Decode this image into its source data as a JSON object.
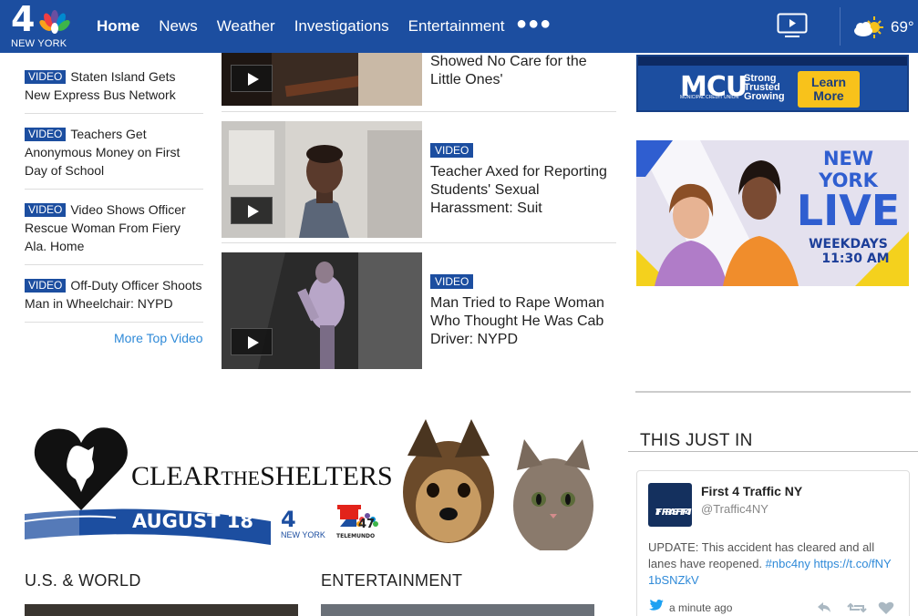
{
  "header": {
    "logo_number": "4",
    "logo_city": "NEW YORK",
    "nav": [
      {
        "label": "Home",
        "active": true
      },
      {
        "label": "News",
        "active": false
      },
      {
        "label": "Weather",
        "active": false
      },
      {
        "label": "Investigations",
        "active": false
      },
      {
        "label": "Entertainment",
        "active": false
      }
    ],
    "more_icon": "ellipsis-icon",
    "tv_icon": "live-tv-icon",
    "weather_icon": "partly-sunny-icon",
    "temperature": "69°",
    "brand_color": "#1c4ea0"
  },
  "left_videos": {
    "badge": "VIDEO",
    "items": [
      {
        "title": "Staten Island Gets New Express Bus Network"
      },
      {
        "title": "Teachers Get Anonymous Money on First Day of School"
      },
      {
        "title": "Video Shows Officer Rescue Woman From Fiery Ala. Home"
      },
      {
        "title": "Off-Duty Officer Shoots Man in Wheelchair: NYPD"
      }
    ],
    "more_link": "More Top Video"
  },
  "middle_videos": {
    "items": [
      {
        "badge": "",
        "title": "Showed No Care for the Little Ones'"
      },
      {
        "badge": "VIDEO",
        "title": "Teacher Axed for Reporting Students' Sexual Harassment: Suit"
      },
      {
        "badge": "VIDEO",
        "title": "Man Tried to Rape Woman Who Thought He Was Cab Driver: NYPD"
      }
    ]
  },
  "ads": {
    "mcu": {
      "logo": "MCU",
      "subtext": "MUNICIPAL CREDIT UNION",
      "tagline": [
        "Strong",
        "Trusted",
        "Growing"
      ],
      "cta": [
        "Learn",
        "More"
      ]
    },
    "nylive": {
      "title_line1": "NEW YORK",
      "title_line2": "LIVE",
      "schedule_line1": "WEEKDAYS",
      "schedule_line2": "11:30 AM"
    },
    "shelters": {
      "title_part1": "CLEAR",
      "title_part2": "THE",
      "title_part3": "SHELTERS",
      "date": "AUGUST 18",
      "logo1_num": "4",
      "logo1_city": "NEW YORK",
      "logo2_num": "47",
      "logo2_name": "TELEMUNDO"
    }
  },
  "this_just_in": {
    "heading": "THIS JUST IN",
    "tweet": {
      "avatar_text": [
        "FIRST4",
        "TRAFFIC"
      ],
      "name": "First 4 Traffic NY",
      "handle": "@Traffic4NY",
      "text": "UPDATE: This accident has cleared and all lanes have reopened.",
      "hashtag": "#nbc4ny",
      "link": "https://t.co/fNY1bSNZkV",
      "time": "a minute ago",
      "actions": [
        "reply-icon",
        "retweet-icon",
        "like-icon"
      ]
    }
  },
  "sections": {
    "us_world": "U.S. & WORLD",
    "entertainment": "ENTERTAINMENT"
  }
}
